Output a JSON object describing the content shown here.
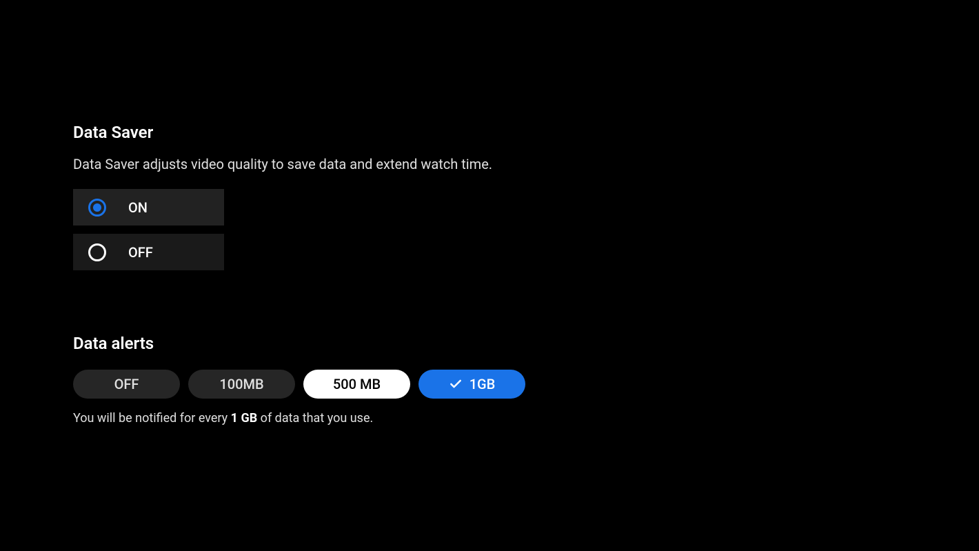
{
  "dataSaver": {
    "title": "Data Saver",
    "description": "Data Saver adjusts video quality to save data and extend watch time.",
    "options": {
      "on": "ON",
      "off": "OFF"
    },
    "selected": "on"
  },
  "dataAlerts": {
    "title": "Data alerts",
    "options": {
      "off": "OFF",
      "100mb": "100MB",
      "500mb": "500 MB",
      "1gb": "1GB"
    },
    "selected": "1gb",
    "notifyPrefix": "You will be notified for every ",
    "notifyAmount": "1 GB",
    "notifySuffix": " of data that you use."
  }
}
